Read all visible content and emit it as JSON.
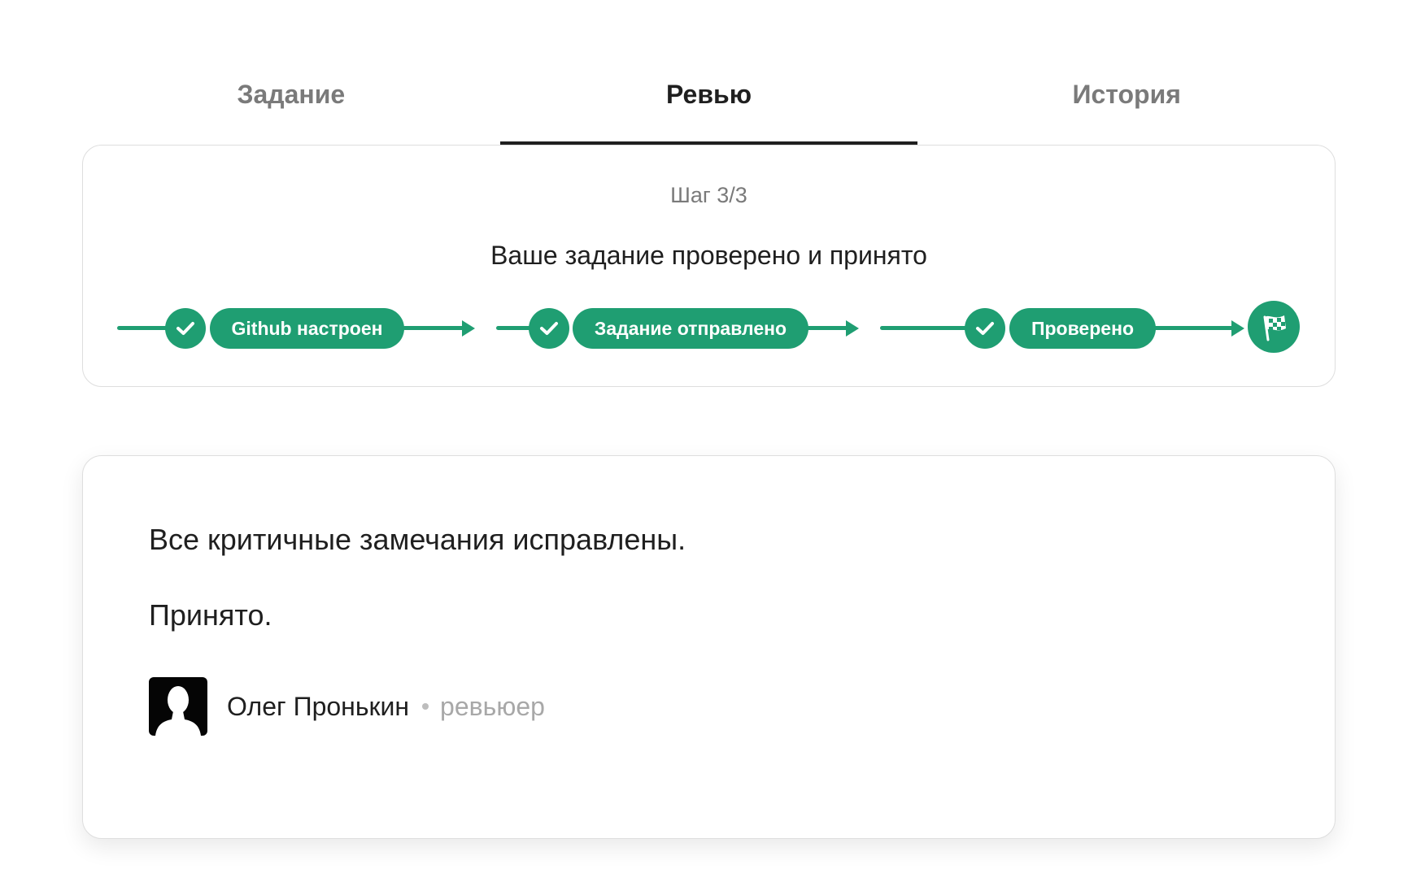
{
  "tabs": [
    {
      "label": "Задание",
      "active": false
    },
    {
      "label": "Ревью",
      "active": true
    },
    {
      "label": "История",
      "active": false
    }
  ],
  "status": {
    "step": "Шаг 3/3",
    "title": "Ваше задание проверено и принято",
    "steps": [
      {
        "label": "Github настроен",
        "done": true
      },
      {
        "label": "Задание отправлено",
        "done": true
      },
      {
        "label": "Проверено",
        "done": true
      }
    ],
    "finish_icon": "flag-icon",
    "check_icon": "check-icon",
    "accent_color": "#1f9e72"
  },
  "review": {
    "paragraphs": [
      "Все критичные замечания исправлены.",
      "Принято."
    ],
    "author_name": "Олег Пронькин",
    "author_role": "ревьюер"
  }
}
